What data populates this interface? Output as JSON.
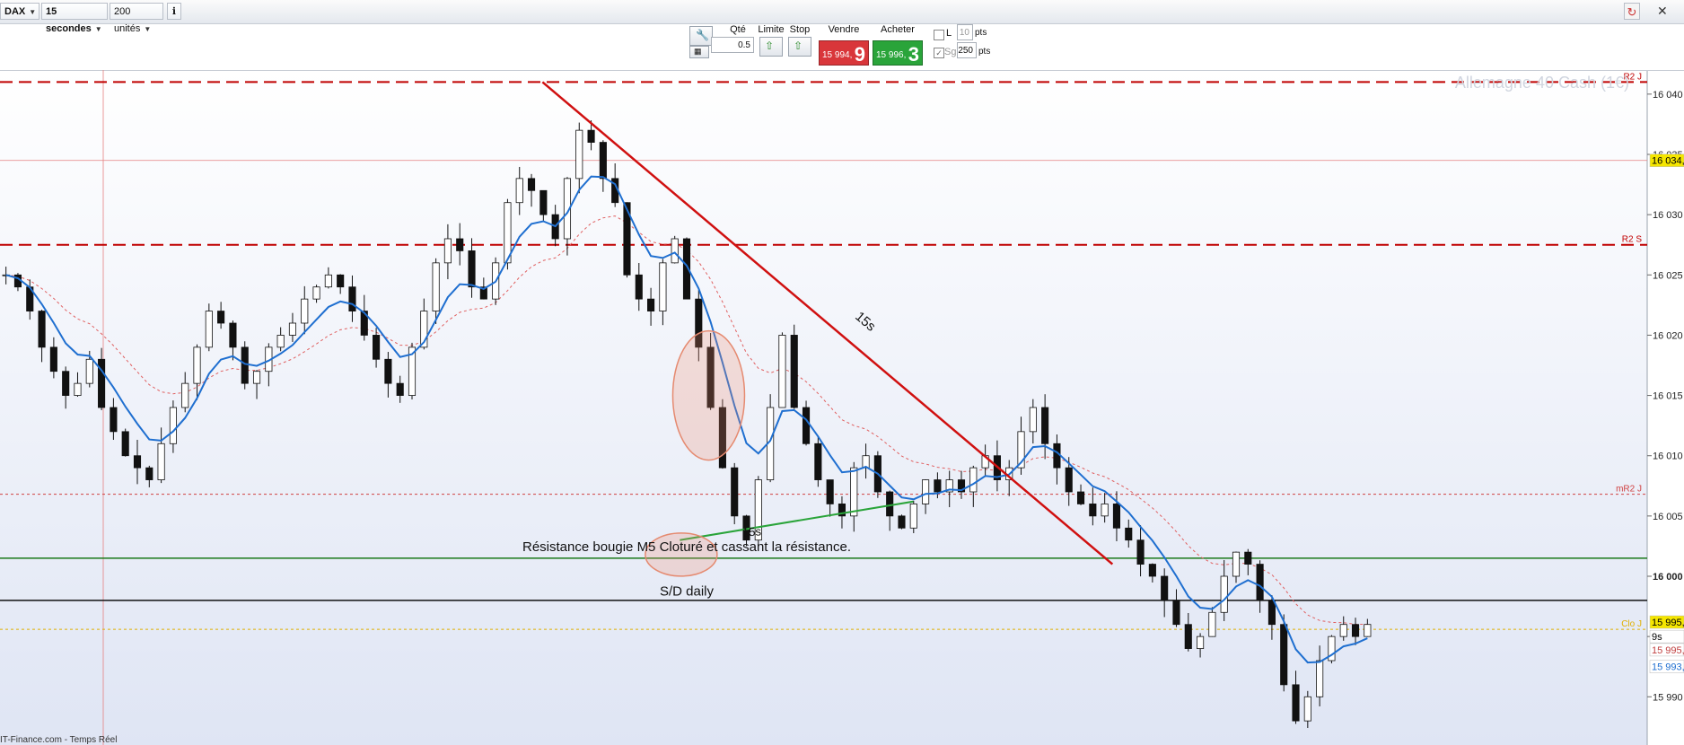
{
  "toolbar": {
    "instrument": "DAX",
    "timeframe": "15 secondes",
    "units": "200 unités",
    "info_icon": "info-icon",
    "refresh_icon": "refresh-icon",
    "close_icon": "close-icon"
  },
  "order_panel": {
    "qty_label": "Qté",
    "qty_value": "0.5",
    "limit_label": "Limite",
    "stop_label": "Stop",
    "sell_label": "Vendre",
    "sell_price": "15 994,",
    "sell_big": "9",
    "buy_label": "Acheter",
    "buy_price": "15 996,",
    "buy_big": "3",
    "l_label": "L",
    "l_value": "10",
    "l_unit": "pts",
    "sg_label": "Sg",
    "sg_value": "250",
    "sg_unit": "pts",
    "colors": {
      "sell": "#d9363a",
      "buy": "#2aa43a"
    }
  },
  "chart_data": {
    "type": "candlestick",
    "title": "Allemagne 40 Cash (1€)",
    "footer": "IT-Finance.com - Temps Réel",
    "ylim": [
      15986,
      16042
    ],
    "y_ticks": [
      "16 040",
      "16 035",
      "16 030",
      "16 025",
      "16 020",
      "16 015",
      "16 010",
      "16 005",
      "16 000",
      "15 995",
      "15 990"
    ],
    "y_tick_values": [
      16040,
      16035,
      16030,
      16025,
      16020,
      16015,
      16010,
      16005,
      16000,
      15995,
      15990
    ],
    "levels": [
      {
        "name": "R2 J",
        "value": 16041,
        "color": "#c00000",
        "style": "dashed-heavy"
      },
      {
        "name": "",
        "value": 16034.5,
        "color": "#e58080",
        "style": "solid-thin"
      },
      {
        "name": "R2 S",
        "value": 16027.5,
        "color": "#c00000",
        "style": "dashed-heavy"
      },
      {
        "name": "mR2 J",
        "value": 16006.8,
        "color": "#d04040",
        "style": "dotted"
      },
      {
        "name": "",
        "value": 16001.5,
        "color": "#1a7a1a",
        "style": "solid"
      },
      {
        "name": "",
        "value": 15998,
        "color": "#111111",
        "style": "solid"
      },
      {
        "name": "Clo J",
        "value": 15995.6,
        "color": "#e0b000",
        "style": "dotted"
      }
    ],
    "price_labels": [
      {
        "text": "16 034,",
        "value": 16034.5,
        "bg": "#f5e600",
        "fg": "#000"
      },
      {
        "text": "15 995,",
        "value": 15996.2,
        "bg": "#f5e600",
        "fg": "#000"
      },
      {
        "text": "9s",
        "value": 15995.0,
        "bg": "#ffffff",
        "fg": "#000"
      },
      {
        "text": "15 995,",
        "value": 15993.9,
        "bg": "#ffffff",
        "fg": "#c04040"
      },
      {
        "text": "15 993,",
        "value": 15992.5,
        "bg": "#ffffff",
        "fg": "#1f6fd0"
      }
    ],
    "annotations": {
      "trend_label": "15s",
      "support_label": "15s",
      "resistance_text": "Résistance bougie M5 Cloturé et cassant la résistance.",
      "sd_text": "S/D daily"
    },
    "trendline": {
      "from": [
        0.395,
        16041
      ],
      "to": [
        0.81,
        16001
      ]
    },
    "support_line": {
      "from": [
        0.495,
        16003
      ],
      "to": [
        0.665,
        16006.2
      ]
    },
    "close_series": [
      16025,
      16024,
      16022,
      16019,
      16017,
      16015,
      16016,
      16018,
      16014,
      16012,
      16010,
      16009,
      16008,
      16011,
      16014,
      16016,
      16019,
      16022,
      16021,
      16019,
      16016,
      16017,
      16019,
      16020,
      16021,
      16023,
      16024,
      16025,
      16024,
      16022,
      16020,
      16018,
      16016,
      16015,
      16019,
      16022,
      16026,
      16028,
      16027,
      16024,
      16023,
      16026,
      16031,
      16033,
      16032,
      16030,
      16028,
      16033,
      16037,
      16036,
      16033,
      16031,
      16025,
      16023,
      16022,
      16026,
      16028,
      16023,
      16019,
      16014,
      16009,
      16005,
      16003,
      16008,
      16014,
      16020,
      16014,
      16011,
      16008,
      16006,
      16005,
      16009,
      16010,
      16007,
      16005,
      16004,
      16006,
      16008,
      16007,
      16008,
      16007,
      16009,
      16010,
      16008,
      16009,
      16012,
      16014,
      16011,
      16009,
      16007,
      16006,
      16005,
      16006,
      16004,
      16003,
      16001,
      16000,
      15998,
      15996,
      15994,
      15995,
      15997,
      16000,
      16002,
      16001,
      15998,
      15996,
      15991,
      15988,
      15990,
      15993,
      15995,
      15996,
      15995,
      15996
    ]
  }
}
